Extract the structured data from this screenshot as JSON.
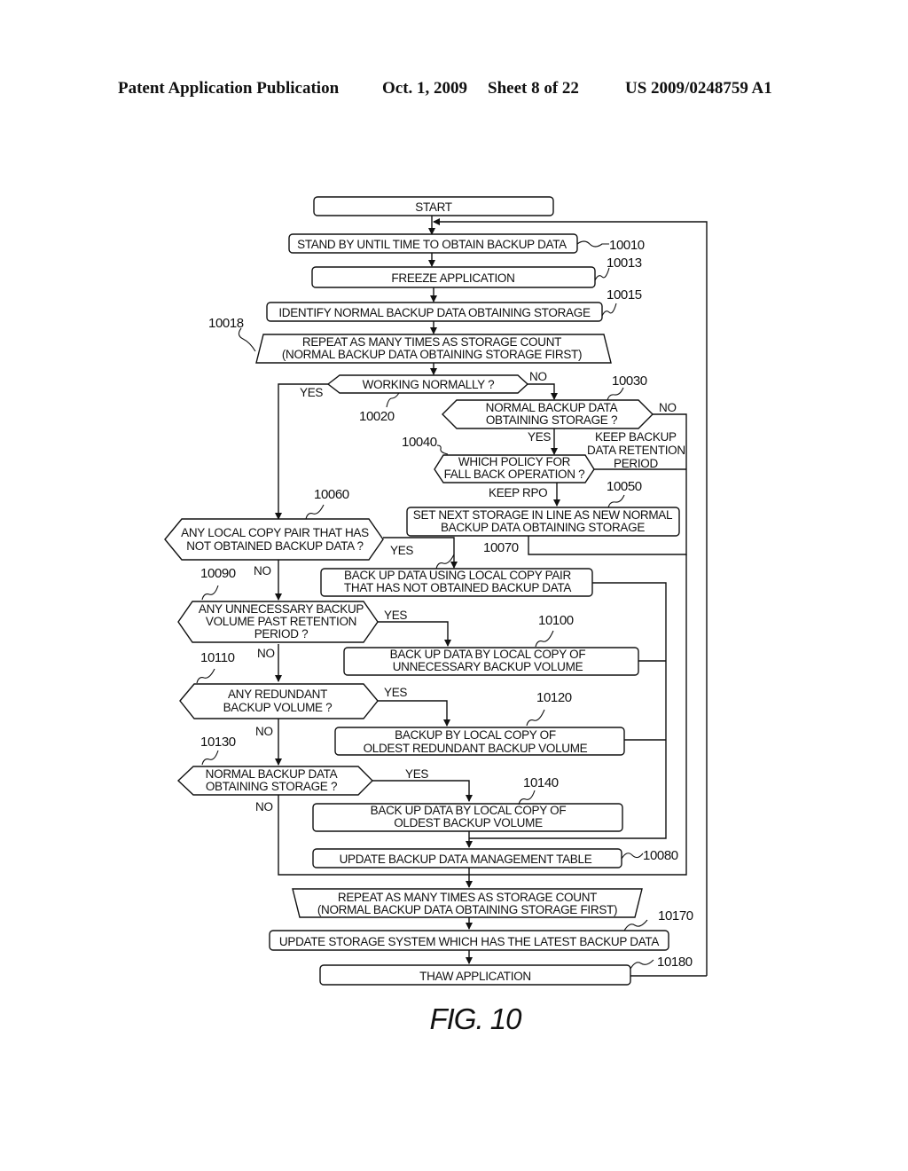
{
  "header": {
    "left": "Patent Application Publication",
    "date": "Oct. 1, 2009",
    "sheet": "Sheet 8 of 22",
    "pub_number": "US 2009/0248759 A1"
  },
  "figure_label": "FIG. 10",
  "steps": {
    "start": {
      "text": [
        "START"
      ]
    },
    "s10010": {
      "ref": "10010",
      "text": [
        "STAND BY UNTIL TIME TO OBTAIN BACKUP DATA"
      ]
    },
    "s10013": {
      "ref": "10013",
      "text": [
        "FREEZE APPLICATION"
      ]
    },
    "s10015": {
      "ref": "10015",
      "text": [
        "IDENTIFY NORMAL BACKUP DATA OBTAINING STORAGE"
      ]
    },
    "s10018": {
      "ref": "10018",
      "text": [
        "REPEAT AS MANY TIMES AS STORAGE COUNT",
        "(NORMAL BACKUP DATA OBTAINING STORAGE FIRST)"
      ]
    },
    "s10020": {
      "ref": "10020",
      "text": [
        "WORKING NORMALLY ?"
      ]
    },
    "s10030": {
      "ref": "10030",
      "text": [
        "NORMAL BACKUP DATA",
        "OBTAINING STORAGE ?"
      ]
    },
    "s10040": {
      "ref": "10040",
      "text": [
        "WHICH POLICY FOR",
        "FALL BACK OPERATION ?"
      ]
    },
    "s10050": {
      "ref": "10050",
      "text": [
        "SET NEXT STORAGE IN LINE AS NEW NORMAL",
        "BACKUP DATA OBTAINING STORAGE"
      ]
    },
    "s10060": {
      "ref": "10060",
      "text": [
        "ANY LOCAL COPY PAIR THAT HAS",
        "NOT OBTAINED BACKUP DATA ?"
      ]
    },
    "s10070": {
      "ref": "10070",
      "text": [
        "BACK UP DATA USING LOCAL COPY PAIR",
        "THAT HAS NOT OBTAINED BACKUP DATA"
      ]
    },
    "s10090": {
      "ref": "10090",
      "text": [
        "ANY UNNECESSARY BACKUP",
        "VOLUME PAST RETENTION",
        "PERIOD ?"
      ]
    },
    "s10100": {
      "ref": "10100",
      "text": [
        "BACK UP DATA BY LOCAL COPY OF",
        "UNNECESSARY BACKUP VOLUME"
      ]
    },
    "s10110": {
      "ref": "10110",
      "text": [
        "ANY REDUNDANT",
        "BACKUP VOLUME ?"
      ]
    },
    "s10120": {
      "ref": "10120",
      "text": [
        "BACKUP BY LOCAL COPY OF",
        "OLDEST REDUNDANT BACKUP VOLUME"
      ]
    },
    "s10130": {
      "ref": "10130",
      "text": [
        "NORMAL BACKUP DATA",
        "OBTAINING STORAGE ?"
      ]
    },
    "s10140": {
      "ref": "10140",
      "text": [
        "BACK UP DATA BY LOCAL COPY OF",
        "OLDEST BACKUP VOLUME"
      ]
    },
    "s10080": {
      "ref": "10080",
      "text": [
        "UPDATE BACKUP DATA MANAGEMENT TABLE"
      ]
    },
    "loop_end": {
      "text": [
        "REPEAT AS MANY TIMES AS STORAGE COUNT",
        "(NORMAL BACKUP DATA OBTAINING STORAGE FIRST)"
      ]
    },
    "s10170": {
      "ref": "10170",
      "text": [
        "UPDATE STORAGE SYSTEM WHICH HAS THE LATEST BACKUP DATA"
      ]
    },
    "s10180": {
      "ref": "10180",
      "text": [
        "THAW APPLICATION"
      ]
    }
  },
  "branch_labels": {
    "yes": "YES",
    "no": "NO",
    "keep_rpo": "KEEP RPO",
    "keep_retention": [
      "KEEP BACKUP",
      "DATA RETENTION",
      "PERIOD"
    ]
  }
}
